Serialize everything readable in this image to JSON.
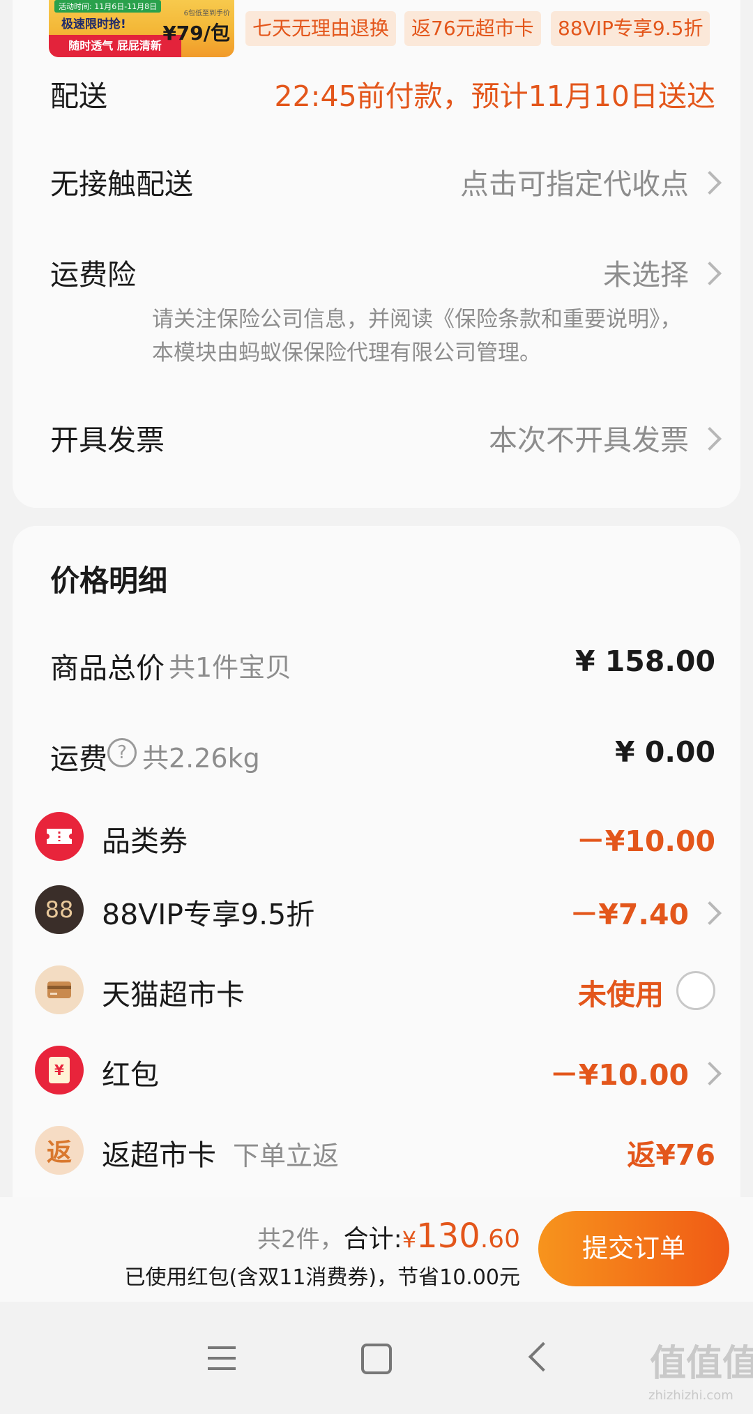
{
  "product": {
    "thumb_activity": "活动时间: 11月6日-11月8日",
    "thumb_headline": "极速限时抢!",
    "thumb_banner": "随时透气 屁屁清新",
    "thumb_note": "6包低至到手价",
    "thumb_price": "¥79/包",
    "tags": [
      "七天无理由退换",
      "返76元超市卡",
      "88VIP专享9.5折"
    ]
  },
  "delivery": {
    "label": "配送",
    "value": "22:45前付款，预计11月10日送达"
  },
  "contactless": {
    "label": "无接触配送",
    "value": "点击可指定代收点"
  },
  "shipping_insurance": {
    "label": "运费险",
    "value": "未选择",
    "note": "请关注保险公司信息，并阅读《保险条款和重要说明》，本模块由蚂蚁保保险代理有限公司管理。"
  },
  "invoice": {
    "label": "开具发票",
    "value": "本次不开具发票"
  },
  "price_detail": {
    "title": "价格明细",
    "goods_total_label": "商品总价",
    "goods_total_sub": "共1件宝贝",
    "goods_total_value": "¥ 158.00",
    "shipping_label": "运费",
    "shipping_sub": "共2.26kg",
    "shipping_value": "¥ 0.00",
    "items": [
      {
        "label": "品类券",
        "sub": "",
        "value": "－¥10.00",
        "icon": "ticket-icon",
        "color": "#e8243b"
      },
      {
        "label": "88VIP专享9.5折",
        "sub": "",
        "value": "－¥7.40",
        "icon": "88vip-icon",
        "color": "#3a2e29"
      },
      {
        "label": "天猫超市卡",
        "sub": "",
        "value": "未使用",
        "icon": "card-icon",
        "color": "#f3dcc2"
      },
      {
        "label": "红包",
        "sub": "",
        "value": "－¥10.00",
        "icon": "red-packet-icon",
        "color": "#e8243b"
      },
      {
        "label": "返超市卡",
        "sub": "下单立返",
        "value": "返¥76",
        "icon": "rebate-icon",
        "color": "#f6dcc4"
      }
    ],
    "icon_glyphs": {
      "vip": "88",
      "rebate": "返",
      "packet": "¥"
    }
  },
  "footer": {
    "count": "共2件，",
    "total_label": "合计:",
    "currency": "¥",
    "total_int": "130",
    "total_dec": ".60",
    "note": "已使用红包(含双11消费券)，节省10.00元",
    "submit_label": "提交订单"
  },
  "watermark": {
    "logo": "值值值",
    "url": "zhizhizhi.com"
  },
  "colors": {
    "accent": "#e3561b",
    "button_start": "#f7941d",
    "button_end": "#f05a15"
  }
}
